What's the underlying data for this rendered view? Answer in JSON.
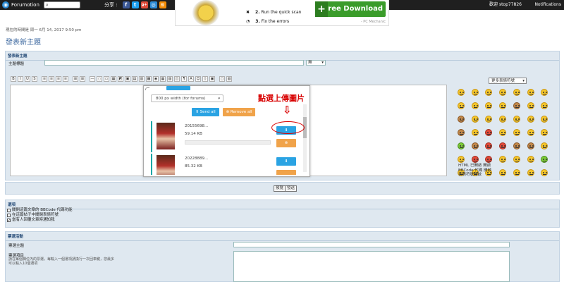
{
  "topbar": {
    "brand": "Forumotion",
    "share_label": "分享 :",
    "welcome": "歡迎 stop77826",
    "notifications": "Notifications",
    "social": [
      {
        "icon": "facebook-icon",
        "glyph": "f",
        "color": "#3b5998"
      },
      {
        "icon": "twitter-icon",
        "glyph": "t",
        "color": "#1da1f2"
      },
      {
        "icon": "google-plus-icon",
        "glyph": "g+",
        "color": "#dd4b39"
      },
      {
        "icon": "share-icon",
        "glyph": "◎",
        "color": "#2d8cd6"
      },
      {
        "icon": "rss-icon",
        "glyph": "≋",
        "color": "#f48c06"
      }
    ]
  },
  "ad": {
    "step2_num": "2.",
    "step2": "Run the quick scan",
    "step3_num": "3.",
    "step3": "Fix the errors",
    "download": "Free Download",
    "sponsor": "- PC Mechanic"
  },
  "date_text": "現在的時間是 周一 6月 14, 2017 9:50 pm",
  "page_title": "發表新主題",
  "post_section": {
    "header": "發表新主題",
    "subject_label": "主題標題",
    "subject_value": "",
    "icon_select": "無"
  },
  "toolbar": [
    "B",
    "I",
    "U",
    "S",
    "≡",
    "≡",
    "≡",
    "≡",
    "☰",
    "☰",
    "—",
    "◌",
    "▭",
    "▦",
    "◩",
    "▣",
    "▤",
    "▥",
    "▩",
    "◉",
    "▦",
    "▨",
    "◫",
    "¶",
    "A",
    "☺",
    "◊",
    "▣",
    "▢",
    "▧"
  ],
  "upload": {
    "size_select": "800 px width (for forums)",
    "send_all": "Send all",
    "remove_all": "Remove all",
    "items": [
      {
        "filename": "20155698...",
        "size": "59.14 KB"
      },
      {
        "filename": "20228889...",
        "size": "85.32 KB"
      }
    ]
  },
  "annotation": "點選上傳圖片",
  "smilies": {
    "select_label": "更多表情符號",
    "links": [
      "HTML 已開啟 開啟",
      "BBCode 代碼 開啟",
      "表情符號開啟"
    ]
  },
  "buttons": {
    "preview": "預覽",
    "submit": "發送"
  },
  "options": {
    "header": "選項",
    "items": [
      {
        "label": "關閉這篇文章的 BBCode 代碼功能",
        "checked": false
      },
      {
        "label": "在這篇帖子中關閉表情符號",
        "checked": false
      },
      {
        "label": "當有人回覆文章時通知我",
        "checked": true
      }
    ]
  },
  "poll": {
    "header": "票選活動",
    "topic_label": "票選主題",
    "items_label": "票選項目",
    "items_hint": "請在每個欄位內的票選，每輸入一個選項請換行一次回車鍵，您最多可以輸入10個選項"
  }
}
